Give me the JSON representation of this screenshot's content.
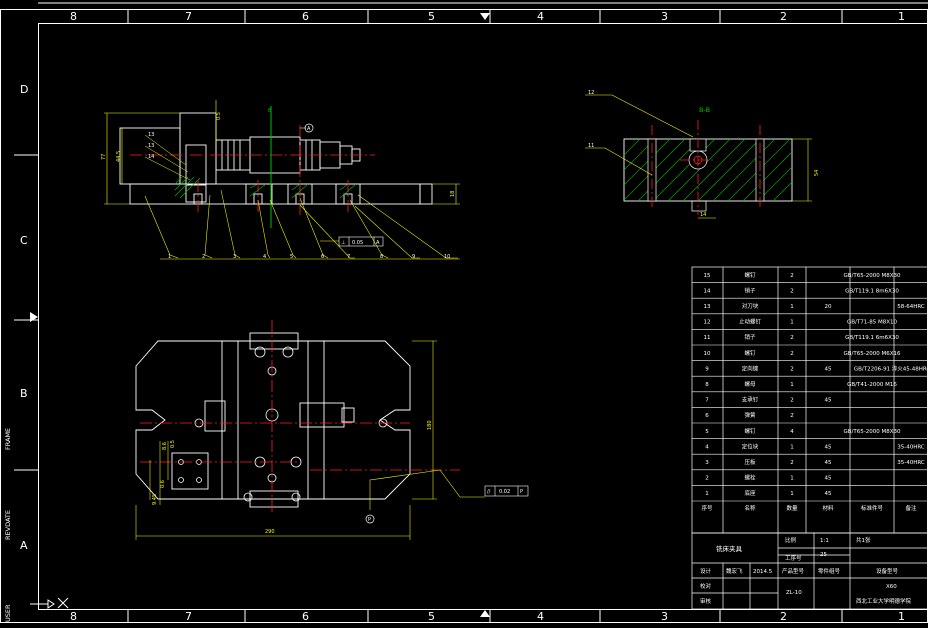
{
  "frame": {
    "col_labels": [
      "8",
      "7",
      "6",
      "5",
      "4",
      "3",
      "2",
      "1"
    ],
    "row_labels": [
      "D",
      "C",
      "B",
      "A"
    ]
  },
  "side_labels": {
    "frame": "FRAME",
    "revdate": "REVDATE",
    "user": "USER"
  },
  "top_view": {
    "dims": {
      "overall_h": "77",
      "inner_h": "44.5",
      "base_h": "18",
      "gap": "0.5"
    },
    "section_mark": "B",
    "callouts": [
      "1",
      "2",
      "3",
      "4",
      "5",
      "6",
      "7",
      "8",
      "9",
      "10"
    ],
    "left_callouts": [
      "13",
      "13",
      "14"
    ],
    "tolerance": {
      "symbol": "⊥",
      "value": "0.05",
      "datum": "A"
    },
    "datum_tag": "A"
  },
  "section_view": {
    "title": "B-B",
    "labels": {
      "top": "12",
      "left": "11"
    },
    "dims": {
      "height": "54",
      "bottom": "14"
    }
  },
  "plan_view": {
    "dims": {
      "width": "290",
      "height": "180",
      "slot_a": "8.6",
      "slot_b": "0.5",
      "slot_c": "9.45",
      "slot_d": "0.6"
    },
    "parallelism": {
      "symbol": "//",
      "value": "0.02",
      "datum": "P"
    },
    "datum_tag": "P"
  },
  "bom": {
    "rows": [
      {
        "no": "15",
        "name": "螺钉",
        "qty": "2",
        "material": "",
        "std": "GB/T65-2000 M8X30",
        "note": ""
      },
      {
        "no": "14",
        "name": "销子",
        "qty": "2",
        "material": "",
        "std": "GB/T119.1 8m6X30",
        "note": ""
      },
      {
        "no": "13",
        "name": "对刀块",
        "qty": "1",
        "material": "20",
        "std": "",
        "note": "58-64HRC"
      },
      {
        "no": "12",
        "name": "止动螺钉",
        "qty": "1",
        "material": "",
        "std": "GB/T71-85 M8X10",
        "note": ""
      },
      {
        "no": "11",
        "name": "销子",
        "qty": "2",
        "material": "",
        "std": "GB/T119.1 6m6X30",
        "note": ""
      },
      {
        "no": "10",
        "name": "螺钉",
        "qty": "2",
        "material": "",
        "std": "GB/T65-2000 M6X16",
        "note": ""
      },
      {
        "no": "9",
        "name": "定向键",
        "qty": "2",
        "material": "45",
        "std": "GB/T2206-91",
        "note": "淬火45-48HRC"
      },
      {
        "no": "8",
        "name": "螺母",
        "qty": "1",
        "material": "",
        "std": "GB/T41-2000 M16",
        "note": ""
      },
      {
        "no": "7",
        "name": "支承钉",
        "qty": "2",
        "material": "45",
        "std": "",
        "note": ""
      },
      {
        "no": "6",
        "name": "弹簧",
        "qty": "2",
        "material": "",
        "std": "",
        "note": ""
      },
      {
        "no": "5",
        "name": "螺钉",
        "qty": "4",
        "material": "",
        "std": "GB/T65-2000 M8X30",
        "note": ""
      },
      {
        "no": "4",
        "name": "定位块",
        "qty": "1",
        "material": "45",
        "std": "",
        "note": "35-40HRC"
      },
      {
        "no": "3",
        "name": "压板",
        "qty": "2",
        "material": "45",
        "std": "",
        "note": "35-40HRC"
      },
      {
        "no": "2",
        "name": "螺栓",
        "qty": "1",
        "material": "45",
        "std": "",
        "note": ""
      },
      {
        "no": "1",
        "name": "底座",
        "qty": "1",
        "material": "45",
        "std": "",
        "note": ""
      }
    ],
    "headers": [
      "序号",
      "名称",
      "数量",
      "材料",
      "标准件号",
      "备注"
    ]
  },
  "title_block": {
    "drawing_title": "铣床夹具",
    "scale_label": "比例",
    "scale_value": "1:1",
    "sheets": "共1张",
    "process_label": "工序号",
    "process_value": "25",
    "design_label": "设计",
    "designer": "魏宏飞",
    "date": "2014.5",
    "product_label": "产品型号",
    "part_label": "零件组号",
    "device_label": "设备型号",
    "device_value": "X60",
    "check_label": "校对",
    "review_label": "审核",
    "product_value": "ZL-10",
    "school": "西北工业大学明德学院"
  },
  "colors": {
    "frame": "#ffffff",
    "part": "#ffffff",
    "center": "#ff2020",
    "dim": "#ffff00",
    "hatch": "#00c000",
    "tol": "#00ffff",
    "bg": "#000000"
  }
}
